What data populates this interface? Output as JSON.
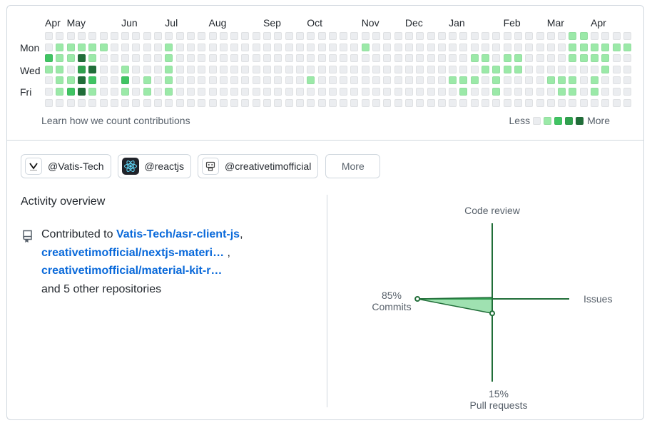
{
  "calendar": {
    "months": [
      "Apr",
      "May",
      "Jun",
      "Jul",
      "Aug",
      "Sep",
      "Oct",
      "Nov",
      "Dec",
      "Jan",
      "Feb",
      "Mar",
      "Apr"
    ],
    "month_cols": [
      0,
      2,
      7,
      11,
      15,
      20,
      24,
      29,
      33,
      37,
      42,
      46,
      50
    ],
    "day_labels": [
      "Mon",
      "Wed",
      "Fri"
    ],
    "level_colors": [
      "#ebedf0",
      "#9be9a8",
      "#40c463",
      "#30a14e",
      "#216e39"
    ],
    "weeks": 54,
    "activity": [
      [
        1,
        1,
        1
      ],
      [
        1,
        2,
        1
      ],
      [
        1,
        3,
        1
      ],
      [
        1,
        4,
        1
      ],
      [
        1,
        5,
        1
      ],
      [
        1,
        11,
        1
      ],
      [
        1,
        29,
        1
      ],
      [
        1,
        48,
        1
      ],
      [
        1,
        49,
        1
      ],
      [
        1,
        50,
        1
      ],
      [
        1,
        51,
        1
      ],
      [
        1,
        52,
        1
      ],
      [
        1,
        53,
        1
      ],
      [
        0,
        48,
        1
      ],
      [
        0,
        49,
        1
      ],
      [
        1,
        48,
        1
      ],
      [
        2,
        0,
        2
      ],
      [
        2,
        1,
        1
      ],
      [
        2,
        2,
        1
      ],
      [
        2,
        3,
        4
      ],
      [
        2,
        4,
        1
      ],
      [
        2,
        11,
        1
      ],
      [
        2,
        39,
        1
      ],
      [
        2,
        40,
        1
      ],
      [
        2,
        42,
        1
      ],
      [
        2,
        43,
        1
      ],
      [
        2,
        48,
        1
      ],
      [
        2,
        49,
        1
      ],
      [
        2,
        50,
        1
      ],
      [
        2,
        51,
        1
      ],
      [
        3,
        0,
        1
      ],
      [
        3,
        1,
        1
      ],
      [
        3,
        3,
        3
      ],
      [
        3,
        4,
        4
      ],
      [
        3,
        7,
        1
      ],
      [
        3,
        11,
        1
      ],
      [
        3,
        40,
        1
      ],
      [
        3,
        41,
        1
      ],
      [
        3,
        42,
        1
      ],
      [
        3,
        43,
        1
      ],
      [
        3,
        51,
        1
      ],
      [
        4,
        1,
        1
      ],
      [
        4,
        2,
        1
      ],
      [
        4,
        3,
        4
      ],
      [
        4,
        4,
        2
      ],
      [
        4,
        7,
        2
      ],
      [
        4,
        9,
        1
      ],
      [
        4,
        11,
        1
      ],
      [
        4,
        24,
        1
      ],
      [
        4,
        37,
        1
      ],
      [
        4,
        38,
        1
      ],
      [
        4,
        39,
        1
      ],
      [
        4,
        41,
        1
      ],
      [
        4,
        46,
        1
      ],
      [
        4,
        47,
        1
      ],
      [
        4,
        48,
        1
      ],
      [
        4,
        50,
        1
      ],
      [
        5,
        1,
        1
      ],
      [
        5,
        2,
        2
      ],
      [
        5,
        3,
        4
      ],
      [
        5,
        4,
        1
      ],
      [
        5,
        7,
        1
      ],
      [
        5,
        9,
        1
      ],
      [
        5,
        11,
        1
      ],
      [
        5,
        38,
        1
      ],
      [
        5,
        41,
        1
      ],
      [
        5,
        47,
        1
      ],
      [
        5,
        48,
        1
      ],
      [
        5,
        50,
        1
      ]
    ],
    "footer_link": "Learn how we count contributions",
    "legend_less": "Less",
    "legend_more": "More"
  },
  "orgs": [
    {
      "name": "@Vatis-Tech",
      "icon": "vatis-logo"
    },
    {
      "name": "@reactjs",
      "icon": "react-logo"
    },
    {
      "name": "@creativetimofficial",
      "icon": "creative-tim-logo"
    }
  ],
  "more_button": "More",
  "activity": {
    "title": "Activity overview",
    "contributed_to": "Contributed to",
    "repos": [
      "Vatis-Tech/asr-client-js",
      "creativetimofficial/nextjs-materi…",
      "creativetimofficial/material-kit-r…"
    ],
    "others": "and 5 other repositories"
  },
  "radar": {
    "code_review": {
      "label": "Code review",
      "percent": null
    },
    "issues": {
      "label": "Issues",
      "percent": null
    },
    "commits": {
      "label": "Commits",
      "percent": "85%",
      "value": 85
    },
    "pull_requests": {
      "label": "Pull requests",
      "percent": "15%",
      "value": 15
    },
    "stroke_color": "#216e39",
    "fill_color": "#40c463"
  }
}
